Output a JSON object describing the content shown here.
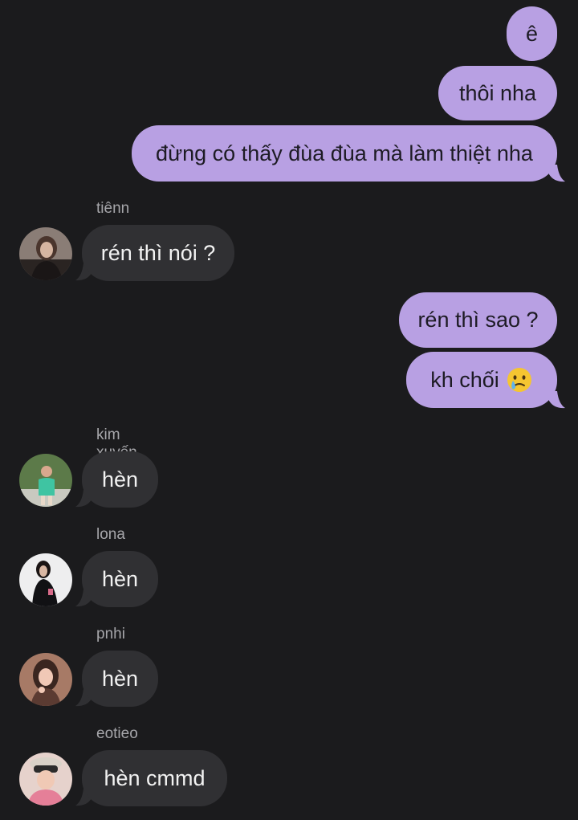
{
  "colors": {
    "background": "#1b1b1d",
    "outgoing_bubble": "#b8a0e3",
    "incoming_bubble": "#303033",
    "sender_name": "#a6a6aa"
  },
  "messages": [
    {
      "direction": "out",
      "text": "ê"
    },
    {
      "direction": "out",
      "text": "thôi nha"
    },
    {
      "direction": "out",
      "text": "đừng có thấy đùa đùa mà làm thiệt nha"
    },
    {
      "direction": "in",
      "sender": "tiênn",
      "text": "rén thì nói ?"
    },
    {
      "direction": "out",
      "text": "rén thì sao ?"
    },
    {
      "direction": "out",
      "text": "kh chối",
      "emoji": "crying-face-emoji"
    },
    {
      "direction": "in",
      "sender": "kim xuyến",
      "text": "hèn"
    },
    {
      "direction": "in",
      "sender": "lona",
      "text": "hèn"
    },
    {
      "direction": "in",
      "sender": "pnhi",
      "text": "hèn"
    },
    {
      "direction": "in",
      "sender": "eotieo",
      "text": "hèn cmmd"
    }
  ]
}
